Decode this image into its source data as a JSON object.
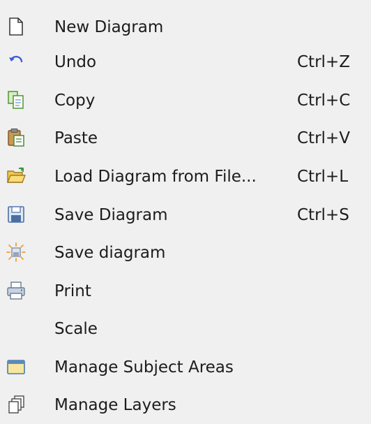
{
  "menu": {
    "items": [
      {
        "label": "New Diagram",
        "shortcut": "",
        "icon": "new-document-icon"
      },
      {
        "label": "Undo",
        "shortcut": "Ctrl+Z",
        "icon": "undo-icon"
      },
      {
        "label": "Copy",
        "shortcut": "Ctrl+C",
        "icon": "copy-icon"
      },
      {
        "label": "Paste",
        "shortcut": "Ctrl+V",
        "icon": "paste-icon"
      },
      {
        "label": "Load Diagram from File...",
        "shortcut": "Ctrl+L",
        "icon": "open-folder-icon"
      },
      {
        "label": "Save Diagram",
        "shortcut": "Ctrl+S",
        "icon": "floppy-disk-icon"
      },
      {
        "label": "Save diagram",
        "shortcut": "",
        "icon": "save-image-icon"
      },
      {
        "label": "Print",
        "shortcut": "",
        "icon": "printer-icon"
      },
      {
        "label": "Scale",
        "shortcut": "",
        "icon": ""
      },
      {
        "label": "Manage Subject Areas",
        "shortcut": "",
        "icon": "window-icon"
      },
      {
        "label": "Manage Layers",
        "shortcut": "",
        "icon": "layers-icon"
      }
    ]
  },
  "colors": {
    "background": "#f0f0f0",
    "text": "#1c1c1c",
    "undo_arrow": "#3b5bdb",
    "copy_green": "#5a9a3a",
    "folder_yellow": "#e8c040",
    "floppy_blue": "#4a6fa5"
  }
}
